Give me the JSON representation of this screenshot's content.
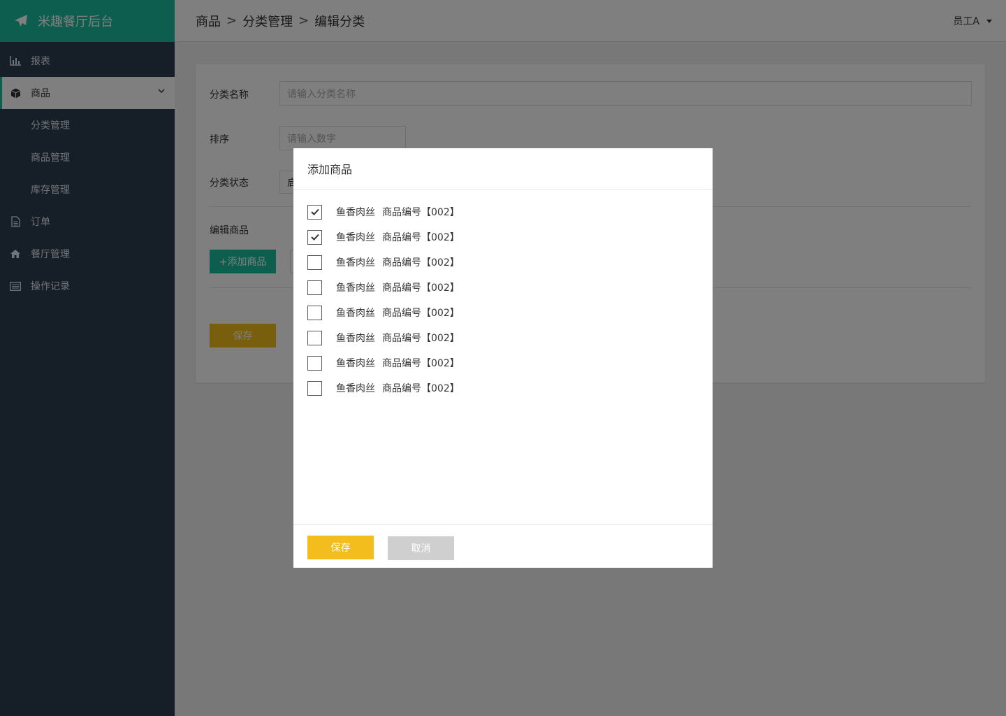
{
  "app": {
    "brand": "米趣餐厅后台"
  },
  "header": {
    "breadcrumb": [
      "商品",
      "分类管理",
      "编辑分类"
    ],
    "separator": ">",
    "user": "员工A"
  },
  "sidebar": {
    "items": [
      {
        "label": "报表",
        "icon": "chart-bar-icon"
      },
      {
        "label": "商品",
        "icon": "cube-icon",
        "active": true,
        "expanded": true
      },
      {
        "label": "分类管理",
        "sub": true
      },
      {
        "label": "商品管理",
        "sub": true
      },
      {
        "label": "库存管理",
        "sub": true
      },
      {
        "label": "订单",
        "icon": "document-icon"
      },
      {
        "label": "餐厅管理",
        "icon": "home-icon"
      },
      {
        "label": "操作记录",
        "icon": "list-icon"
      }
    ]
  },
  "form": {
    "name_label": "分类名称",
    "name_placeholder": "请输入分类名称",
    "sort_label": "排序",
    "sort_placeholder": "请输入数字",
    "status_label": "分类状态",
    "status_value": "启",
    "edit_goods_label": "编辑商品",
    "add_goods_button": "+添加商品",
    "save_button": "保存"
  },
  "modal": {
    "title": "添加商品",
    "items": [
      {
        "name": "鱼香肉丝",
        "code": "商品编号【002】",
        "checked": true
      },
      {
        "name": "鱼香肉丝",
        "code": "商品编号【002】",
        "checked": true
      },
      {
        "name": "鱼香肉丝",
        "code": "商品编号【002】",
        "checked": false
      },
      {
        "name": "鱼香肉丝",
        "code": "商品编号【002】",
        "checked": false
      },
      {
        "name": "鱼香肉丝",
        "code": "商品编号【002】",
        "checked": false
      },
      {
        "name": "鱼香肉丝",
        "code": "商品编号【002】",
        "checked": false
      },
      {
        "name": "鱼香肉丝",
        "code": "商品编号【002】",
        "checked": false
      },
      {
        "name": "鱼香肉丝",
        "code": "商品编号【002】",
        "checked": false
      }
    ],
    "save_button": "保存",
    "cancel_button": "取消"
  },
  "colors": {
    "brand": "#1abc9c",
    "sidebar": "#2d3e50",
    "primary_yellow": "#f3bd1d",
    "cancel_gray": "#cfcfcf"
  }
}
